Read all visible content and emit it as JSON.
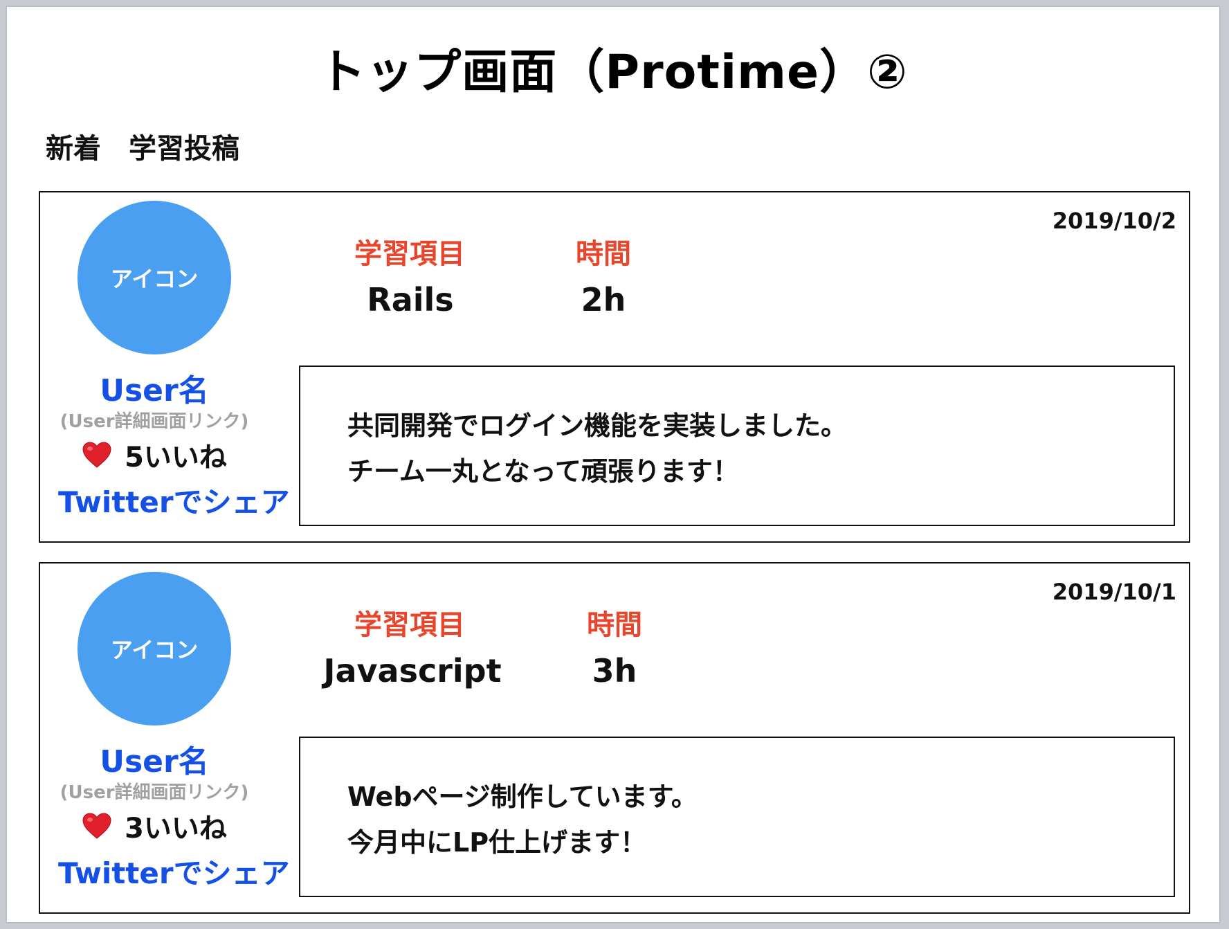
{
  "title": "トップ画面（Protime）②",
  "section_title": "新着　学習投稿",
  "posts": [
    {
      "date": "2019/10/2",
      "avatar_label": "アイコン",
      "user_name": "User名",
      "user_link": "(User詳細画面リンク)",
      "likes": "5いいね",
      "share": "Twitterでシェア",
      "item_label": "学習項目",
      "item_value": "Rails",
      "time_label": "時間",
      "time_value": "2h",
      "body_line1": "共同開発でログイン機能を実装しました。",
      "body_line2": "チーム一丸となって頑張ります！"
    },
    {
      "date": "2019/10/1",
      "avatar_label": "アイコン",
      "user_name": "User名",
      "user_link": "(User詳細画面リンク)",
      "likes": "3いいね",
      "share": "Twitterでシェア",
      "item_label": "学習項目",
      "item_value": "Javascript",
      "time_label": "時間",
      "time_value": "3h",
      "body_line1": "Webページ制作しています。",
      "body_line2": "今月中にLP仕上げます！"
    }
  ],
  "colors": {
    "avatar": "#4a9ff0",
    "link": "#1450e6",
    "label": "#e8452d",
    "heart": "#e0202a"
  },
  "icons": {
    "like": "heart-icon"
  }
}
